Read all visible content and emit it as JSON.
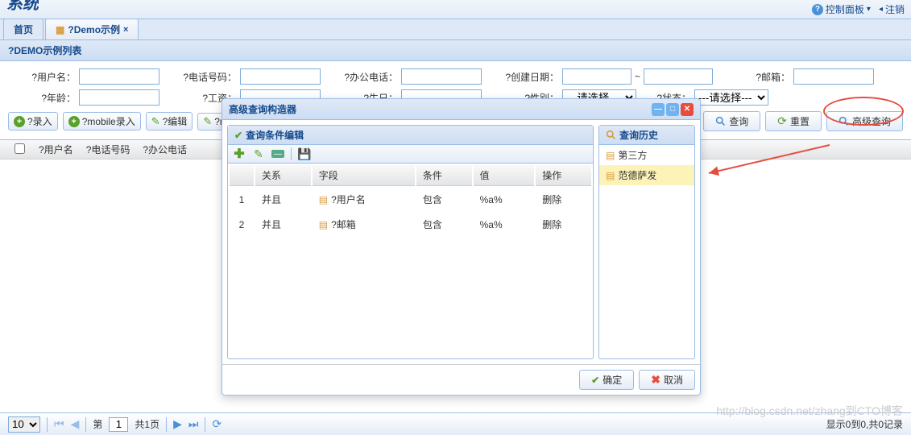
{
  "top": {
    "title_fragment": "系统",
    "control_panel": "控制面板",
    "register": "注销"
  },
  "tabs": {
    "home": "首页",
    "demo": "?Demo示例"
  },
  "section_title": "?DEMO示例列表",
  "filters": {
    "username": "?用户名：",
    "phone": "?电话号码：",
    "office_phone": "?办公电话：",
    "create_date": "?创建日期：",
    "email": "?邮箱：",
    "age": "?年龄：",
    "salary": "?工资：",
    "birthday": "?生日：",
    "gender": "?性别：",
    "gender_placeholder": "---请选择---",
    "status": "?状态：",
    "status_placeholder": "---请选择---"
  },
  "toolbar": {
    "add": "?录入",
    "mobile_add": "?mobile录入",
    "edit": "?编辑",
    "more": "?m",
    "query": "查询",
    "reset": "重置",
    "adv_query": "高级查询"
  },
  "grid": {
    "cols": [
      "?用户名",
      "?电话号码",
      "?办公电话"
    ]
  },
  "modal": {
    "title": "高级查询构造器",
    "cond_title": "查询条件编辑",
    "hist_title": "查询历史",
    "cols": {
      "rel": "关系",
      "field": "字段",
      "cond": "条件",
      "val": "值",
      "op": "操作"
    },
    "rows": [
      {
        "n": "1",
        "rel": "并且",
        "field": "?用户名",
        "cond": "包含",
        "val": "%a%",
        "op": "删除"
      },
      {
        "n": "2",
        "rel": "并且",
        "field": "?邮箱",
        "cond": "包含",
        "val": "%a%",
        "op": "删除"
      }
    ],
    "history": [
      {
        "label": "第三方",
        "selected": false
      },
      {
        "label": "范德萨发",
        "selected": true
      }
    ],
    "ok": "确定",
    "cancel": "取消"
  },
  "paging": {
    "size": "10",
    "page_prefix": "第",
    "page": "1",
    "total_pages": "共1页",
    "summary": "显示0到0,共0记录"
  },
  "watermark": "http://blog.csdn.net/zhang到CTO博客"
}
